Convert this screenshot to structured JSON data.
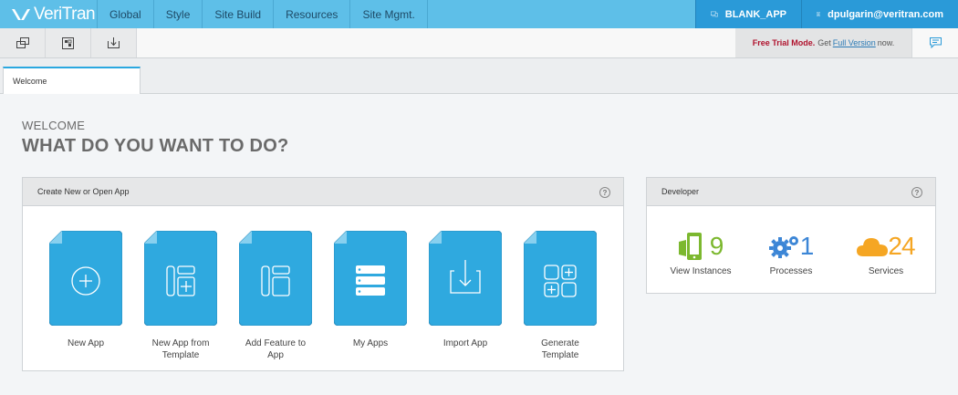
{
  "topnav": {
    "logo_text": "VeriTran",
    "items": [
      "Global",
      "Style",
      "Site Build",
      "Resources",
      "Site Mgmt."
    ],
    "app_label": "BLANK_APP",
    "user_label": "dpulgarin@veritran.com"
  },
  "toolbar": {
    "trial_bold": "Free Trial Mode.",
    "trial_get": "Get",
    "trial_link": "Full Version",
    "trial_end": "now."
  },
  "tabs": {
    "active": "Welcome"
  },
  "header": {
    "subtitle": "WELCOME",
    "title": "WHAT DO YOU WANT TO DO?"
  },
  "create_panel": {
    "title": "Create New or Open App",
    "help": "?",
    "tiles": [
      {
        "line1": "New App",
        "line2": ""
      },
      {
        "line1": "New App from",
        "line2": "Template"
      },
      {
        "line1": "Add Feature to",
        "line2": "App"
      },
      {
        "line1": "My Apps",
        "line2": ""
      },
      {
        "line1": "Import App",
        "line2": ""
      },
      {
        "line1": "Generate",
        "line2": "Template"
      }
    ]
  },
  "developer_panel": {
    "title": "Developer",
    "help": "?",
    "stats": [
      {
        "value": "9",
        "label": "View Instances",
        "color": "#7cb82f"
      },
      {
        "value": "1",
        "label": "Processes",
        "color": "#3c86d6"
      },
      {
        "value": "24",
        "label": "Services",
        "color": "#f5a623"
      }
    ]
  },
  "colors": {
    "topbar": "#5ebfe8",
    "accent": "#2a9ad8",
    "tile": "#2fa9df",
    "trial": "#b0122d"
  }
}
